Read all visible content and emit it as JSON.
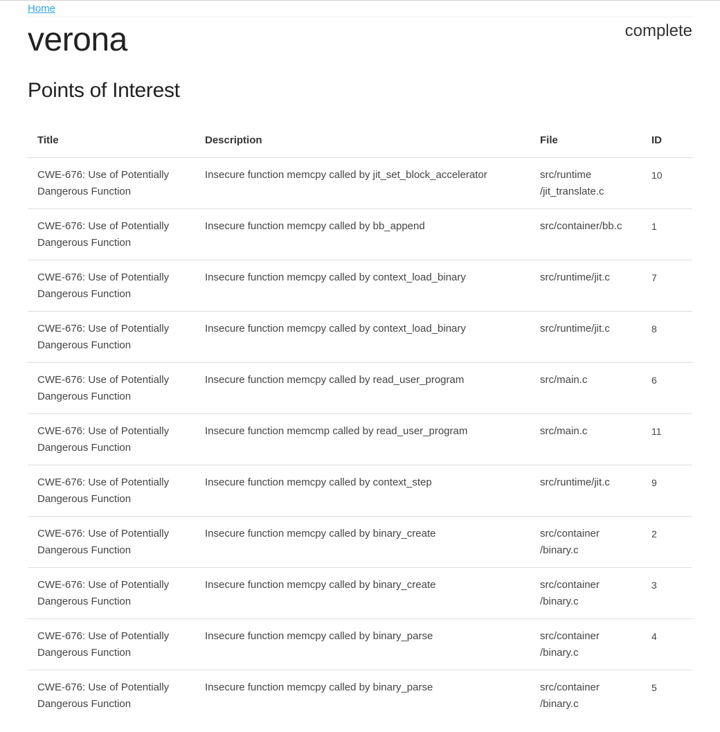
{
  "breadcrumb": {
    "home_label": "Home"
  },
  "project": {
    "name": "verona",
    "status": "complete"
  },
  "section": {
    "title": "Points of Interest"
  },
  "table": {
    "headers": {
      "title": "Title",
      "description": "Description",
      "file": "File",
      "id": "ID"
    },
    "rows": [
      {
        "title": "CWE-676: Use of Potentially Dangerous Function",
        "description": "Insecure function memcpy called by jit_set_block_accelerator",
        "file": "src/runtime\n/jit_translate.c",
        "id": "10"
      },
      {
        "title": "CWE-676: Use of Potentially Dangerous Function",
        "description": "Insecure function memcpy called by bb_append",
        "file": "src/container/bb.c",
        "id": "1"
      },
      {
        "title": "CWE-676: Use of Potentially Dangerous Function",
        "description": "Insecure function memcpy called by context_load_binary",
        "file": "src/runtime/jit.c",
        "id": "7"
      },
      {
        "title": "CWE-676: Use of Potentially Dangerous Function",
        "description": "Insecure function memcpy called by context_load_binary",
        "file": "src/runtime/jit.c",
        "id": "8"
      },
      {
        "title": "CWE-676: Use of Potentially Dangerous Function",
        "description": "Insecure function memcpy called by read_user_program",
        "file": "src/main.c",
        "id": "6"
      },
      {
        "title": "CWE-676: Use of Potentially Dangerous Function",
        "description": "Insecure function memcmp called by read_user_program",
        "file": "src/main.c",
        "id": "11"
      },
      {
        "title": "CWE-676: Use of Potentially Dangerous Function",
        "description": "Insecure function memcpy called by context_step",
        "file": "src/runtime/jit.c",
        "id": "9"
      },
      {
        "title": "CWE-676: Use of Potentially Dangerous Function",
        "description": "Insecure function memcpy called by binary_create",
        "file": "src/container\n/binary.c",
        "id": "2"
      },
      {
        "title": "CWE-676: Use of Potentially Dangerous Function",
        "description": "Insecure function memcpy called by binary_create",
        "file": "src/container\n/binary.c",
        "id": "3"
      },
      {
        "title": "CWE-676: Use of Potentially Dangerous Function",
        "description": "Insecure function memcpy called by binary_parse",
        "file": "src/container\n/binary.c",
        "id": "4"
      },
      {
        "title": "CWE-676: Use of Potentially Dangerous Function",
        "description": "Insecure function memcpy called by binary_parse",
        "file": "src/container\n/binary.c",
        "id": "5"
      }
    ]
  },
  "colors": {
    "link": "#2fa4e7",
    "text": "#333333",
    "divider": "#dddddd"
  }
}
